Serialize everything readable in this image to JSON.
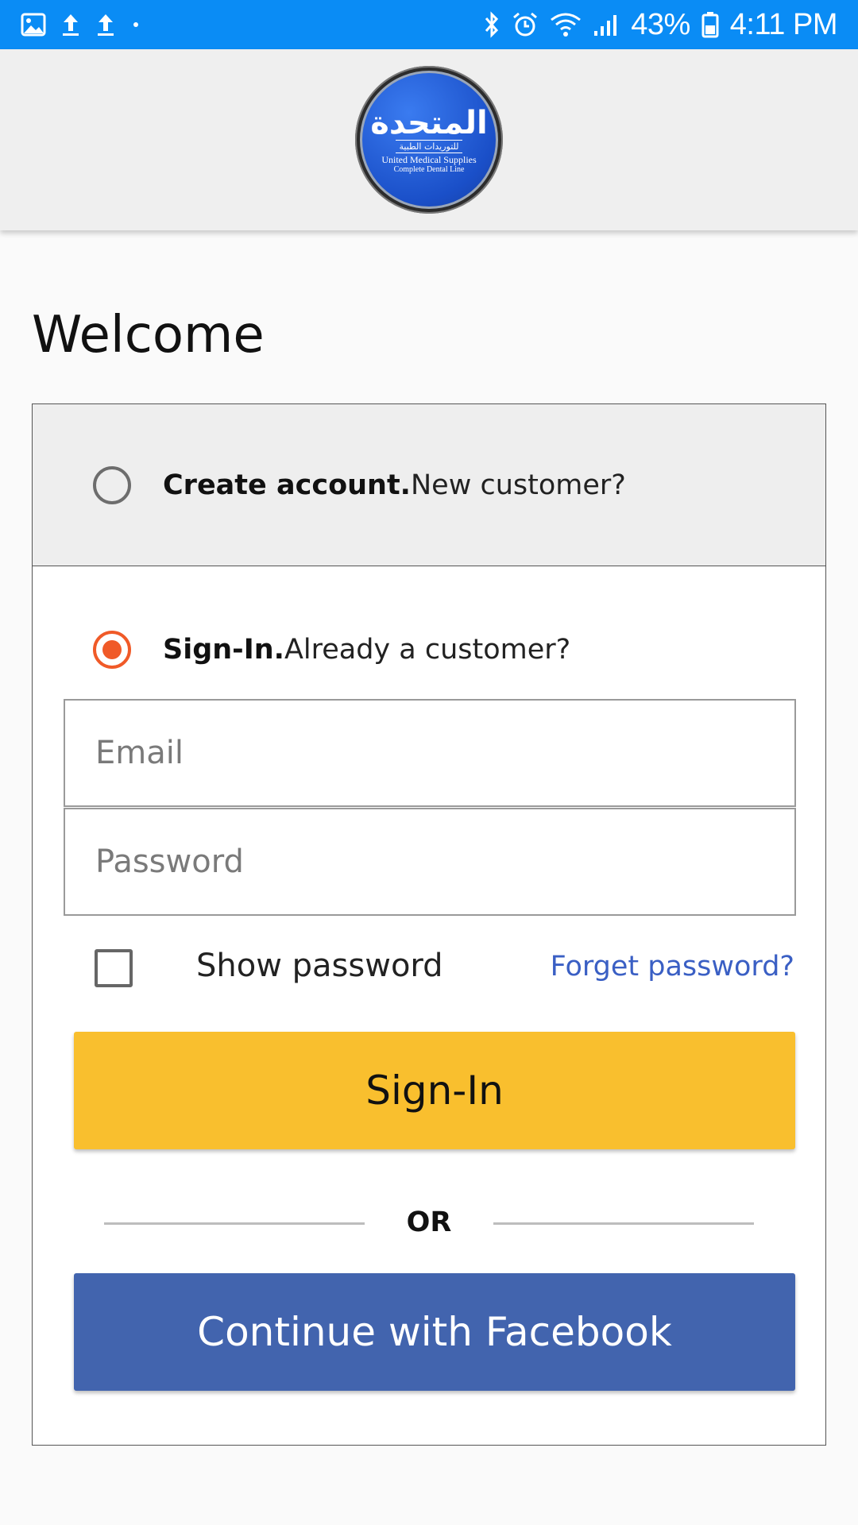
{
  "status_bar": {
    "battery": "43%",
    "time": "4:11 PM",
    "left_icons": [
      "image-icon",
      "upload-icon",
      "upload-icon",
      "dot-icon"
    ],
    "right_icons": [
      "bluetooth-icon",
      "alarm-icon",
      "wifi-icon",
      "signal-icon",
      "battery-icon"
    ]
  },
  "header": {
    "logo": {
      "arabic_name": "المتحدة",
      "arabic_sub": "للتوريدات الطبية",
      "english_name": "United Medical Supplies",
      "tagline": "Complete Dental Line"
    }
  },
  "page": {
    "title": "Welcome"
  },
  "auth": {
    "create_account": {
      "bold": "Create account.",
      "text": "New customer?",
      "selected": false
    },
    "sign_in": {
      "bold": "Sign-In.",
      "text": "Already a customer?",
      "selected": true
    },
    "email_placeholder": "Email",
    "password_placeholder": "Password",
    "show_password_label": "Show password",
    "show_password_checked": false,
    "forgot_password": "Forget password?",
    "sign_in_button": "Sign-In",
    "or_label": "OR",
    "facebook_button": "Continue with Facebook"
  },
  "colors": {
    "status_bar": "#0a8cf5",
    "accent_radio": "#f05a28",
    "sign_in_button": "#f9bf2e",
    "facebook_button": "#4264ae",
    "link": "#3a5fc4"
  }
}
